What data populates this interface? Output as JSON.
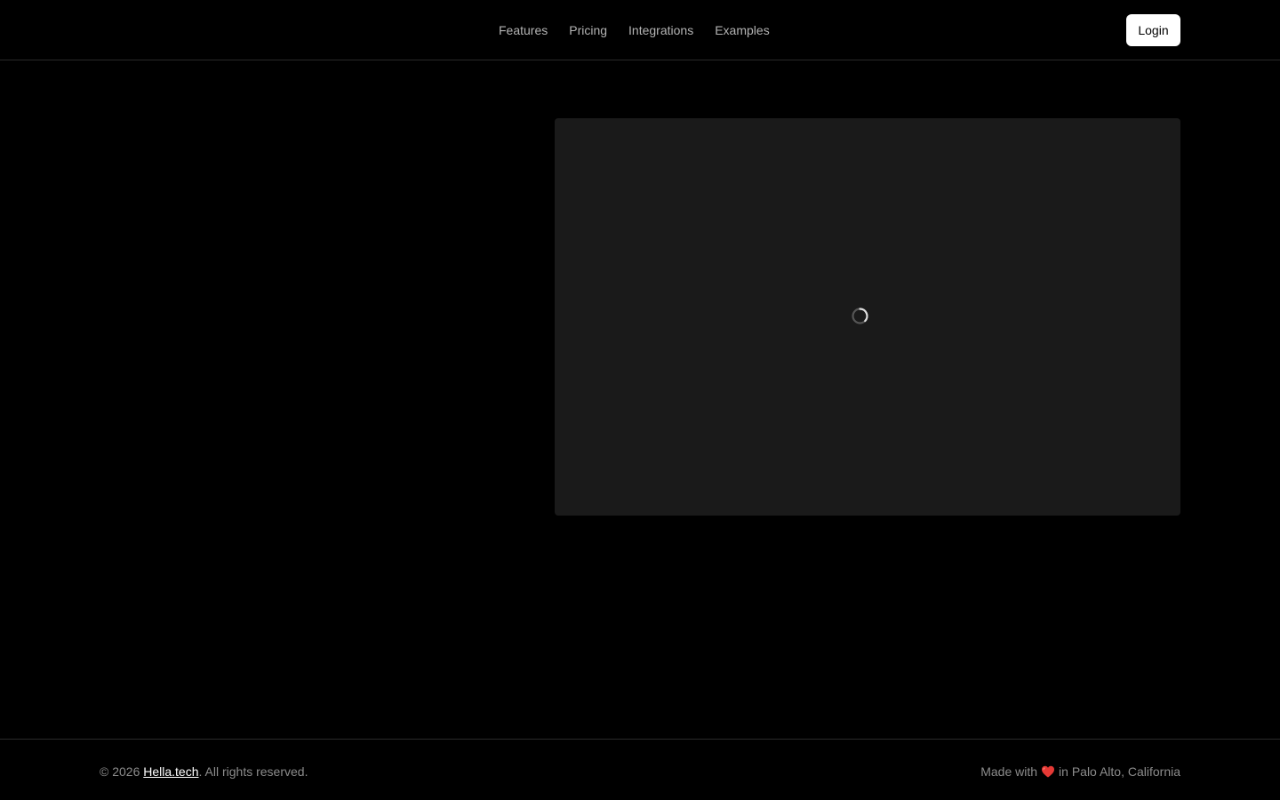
{
  "nav": {
    "items": [
      {
        "label": "Features"
      },
      {
        "label": "Pricing"
      },
      {
        "label": "Integrations"
      },
      {
        "label": "Examples"
      }
    ],
    "login_label": "Login"
  },
  "media": {
    "state": "loading",
    "spinner_icon": "loading-spinner-icon"
  },
  "footer": {
    "copyright_prefix": "© 2026",
    "brand_link": "Hella.tech",
    "copyright_suffix": ". All rights reserved.",
    "made_with": "Made with",
    "heart_icon": "heart-icon",
    "location": "in Palo Alto, California"
  },
  "colors": {
    "background": "#000000",
    "card": "#1a1a1a",
    "muted_text": "#8c8c8c",
    "nav_text": "#b3b3b3",
    "heart": "#e53935"
  }
}
